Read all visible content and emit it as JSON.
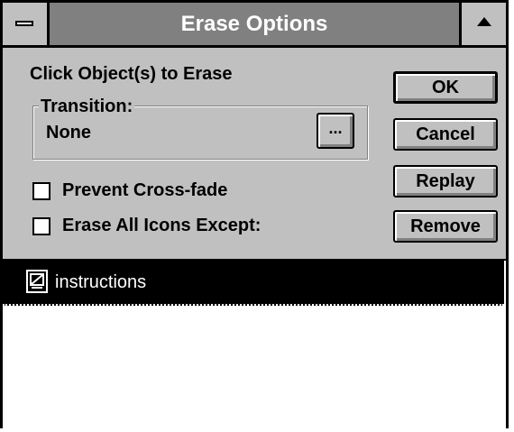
{
  "window": {
    "title": "Erase Options"
  },
  "instructions_label": "Click Object(s) to Erase",
  "transition": {
    "legend": "Transition:",
    "value": "None",
    "browse_label": "..."
  },
  "checkboxes": [
    {
      "label": "Prevent Cross-fade",
      "checked": false
    },
    {
      "label": "Erase All Icons Except:",
      "checked": false
    }
  ],
  "buttons": {
    "ok": "OK",
    "cancel": "Cancel",
    "replay": "Replay",
    "remove": "Remove"
  },
  "list": {
    "items": [
      {
        "label": "instructions",
        "icon": "display-icon",
        "selected": true
      }
    ]
  },
  "colors": {
    "face": "#c0c0c0",
    "titlebar": "#808080",
    "selection": "#000000"
  }
}
